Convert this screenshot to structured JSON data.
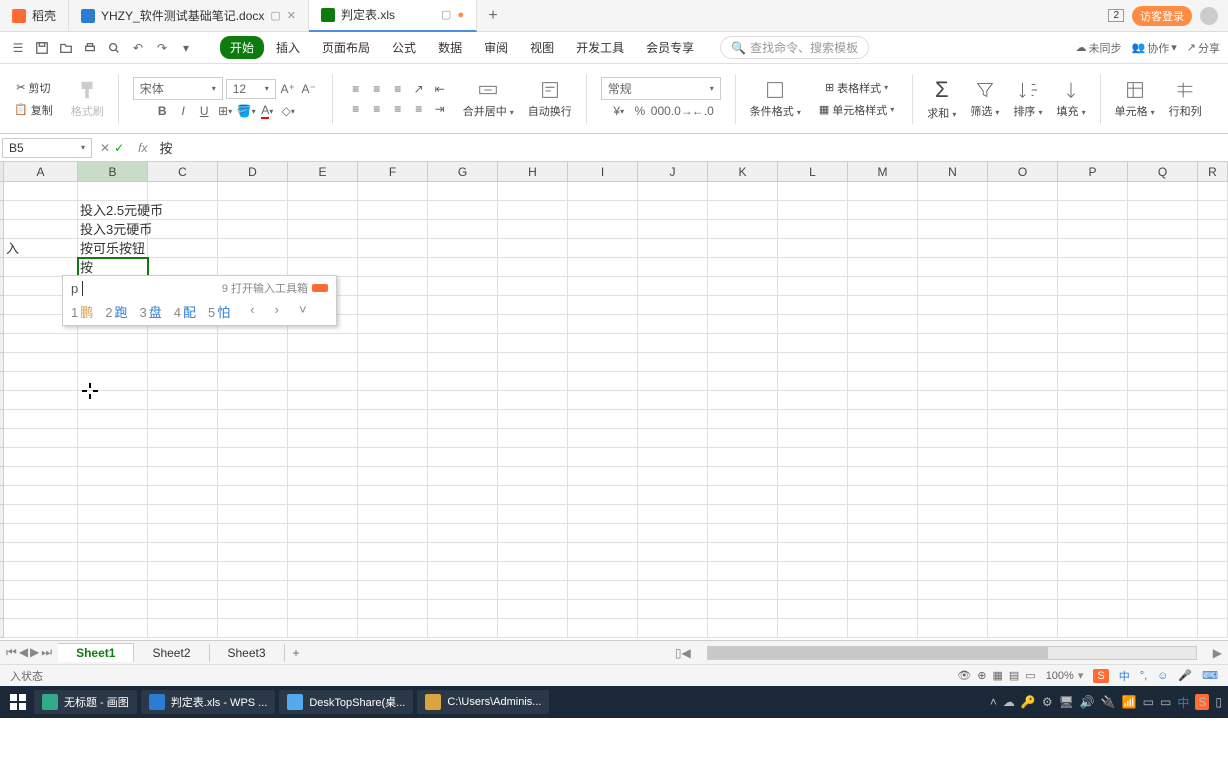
{
  "titlebar": {
    "tabs": [
      {
        "label": "稻壳",
        "type": "d"
      },
      {
        "label": "YHZY_软件测试基础笔记.docx",
        "type": "w"
      },
      {
        "label": "判定表.xls",
        "type": "s",
        "active": true
      }
    ],
    "badge": "2",
    "login": "访客登录"
  },
  "menu": {
    "tabs": [
      "开始",
      "插入",
      "页面布局",
      "公式",
      "数据",
      "审阅",
      "视图",
      "开发工具",
      "会员专享"
    ],
    "active": 0,
    "search": "查找命令、搜索模板",
    "sync": "未同步",
    "collab": "协作",
    "share": "分享"
  },
  "ribbon": {
    "cut": "剪切",
    "copy": "复制",
    "paintfmt": "格式刷",
    "font": "宋体",
    "size": "12",
    "merge": "合并居中",
    "wrap": "自动换行",
    "numfmt": "常规",
    "condfmt": "条件格式",
    "tablestyle": "表格样式",
    "cellstyle": "单元格样式",
    "sum": "求和",
    "filter": "筛选",
    "sort": "排序",
    "fill": "填充",
    "cellmenu": "单元格",
    "rowcol": "行和列"
  },
  "formula": {
    "cellref": "B5",
    "value": "按"
  },
  "columns": [
    "A",
    "B",
    "C",
    "D",
    "E",
    "F",
    "G",
    "H",
    "I",
    "J",
    "K",
    "L",
    "M",
    "N",
    "O",
    "P",
    "Q",
    "R"
  ],
  "cells": {
    "A4": "入",
    "B2": "投入2.5元硬币",
    "B3": "投入3元硬币",
    "B4": "按可乐按钮",
    "B5": "按"
  },
  "ime": {
    "input": "p",
    "hint": "9 打开输入工具箱",
    "candidates": [
      {
        "n": "1",
        "c": "鹏"
      },
      {
        "n": "2",
        "c": "跑"
      },
      {
        "n": "3",
        "c": "盘"
      },
      {
        "n": "4",
        "c": "配"
      },
      {
        "n": "5",
        "c": "怕"
      }
    ]
  },
  "sheets": [
    "Sheet1",
    "Sheet2",
    "Sheet3"
  ],
  "status": {
    "left": "入状态",
    "zoom": "100%"
  },
  "taskbar": {
    "items": [
      {
        "label": "无标题 - 画图",
        "color": "#3a8"
      },
      {
        "label": "判定表.xls - WPS ...",
        "color": "#2b7cd3"
      },
      {
        "label": "DeskTopShare(桌...",
        "color": "#5ae"
      },
      {
        "label": "C:\\Users\\Adminis...",
        "color": "#d9a441"
      }
    ],
    "lang": "中"
  }
}
